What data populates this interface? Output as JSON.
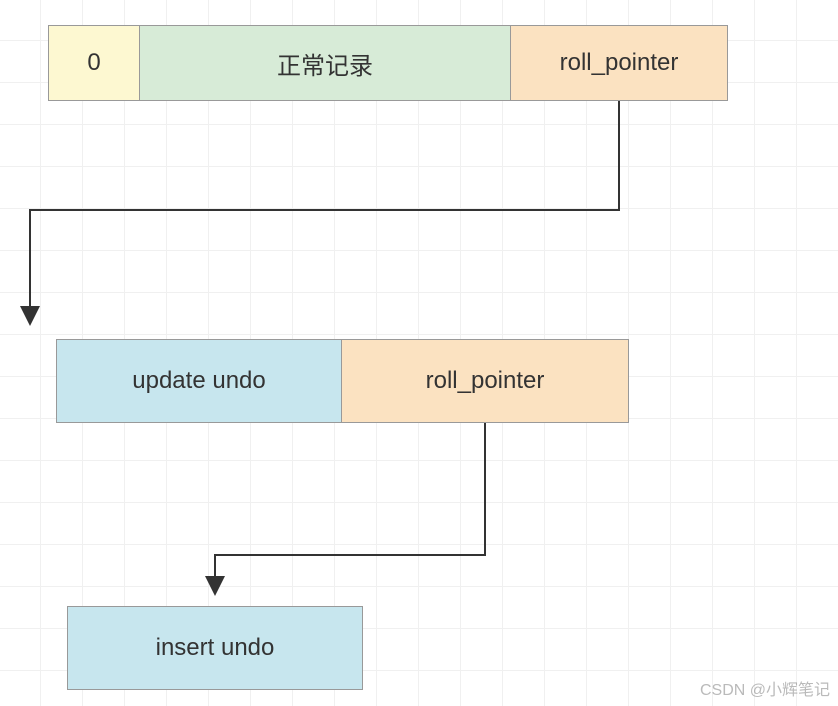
{
  "row1": {
    "zero": "0",
    "normal_record": "正常记录",
    "roll_pointer": "roll_pointer"
  },
  "row2": {
    "update_undo": "update undo",
    "roll_pointer": "roll_pointer"
  },
  "row3": {
    "insert_undo": "insert undo"
  },
  "watermark": "CSDN @小辉笔记"
}
